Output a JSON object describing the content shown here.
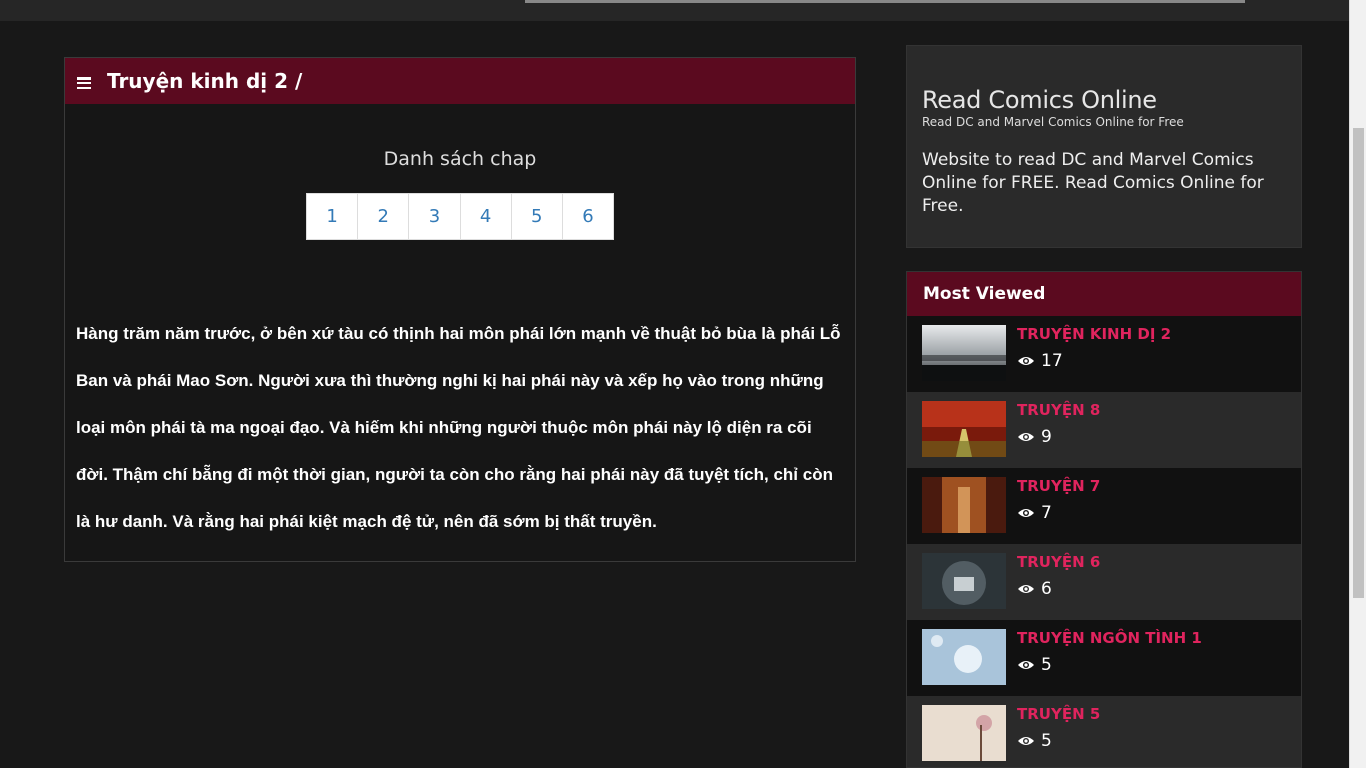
{
  "panel": {
    "title": "Truyện kinh dị 2 /",
    "chap_heading": "Danh sách chap",
    "pages": [
      "1",
      "2",
      "3",
      "4",
      "5",
      "6"
    ],
    "description": "Hàng trăm năm trước, ở bên xứ tàu có thịnh hai môn phái lớn mạnh về thuật bỏ bùa là phái Lỗ Ban và phái Mao Sơn. Người xưa thì thường nghi kị hai phái này và xếp họ vào trong những loại môn phái tà ma ngoại đạo. Và hiếm khi những người thuộc môn phái này lộ diện ra cõi đời. Thậm chí bẵng đi một thời gian, người ta còn cho rằng hai phái này đã tuyệt tích, chỉ còn là hư danh. Và rằng hai phái kiệt mạch đệ tử, nên đã sớm bị thất truyền."
  },
  "about": {
    "title": "Read Comics Online",
    "subtitle": "Read DC and Marvel Comics Online for Free",
    "text": "Website to read DC and Marvel Comics Online for FREE. Read Comics Online for Free."
  },
  "most_viewed": {
    "heading": "Most Viewed",
    "items": [
      {
        "name": "Truyện kinh dị 2",
        "views": "17"
      },
      {
        "name": "Truyện 8",
        "views": "9"
      },
      {
        "name": "Truyện 7",
        "views": "7"
      },
      {
        "name": "Truyện 6",
        "views": "6"
      },
      {
        "name": "Truyện ngôn tình 1",
        "views": "5"
      },
      {
        "name": "Truyện 5",
        "views": "5"
      }
    ]
  },
  "colors": {
    "accent": "#5b0a1f",
    "link": "#e0245e",
    "page_link": "#337ab7"
  }
}
